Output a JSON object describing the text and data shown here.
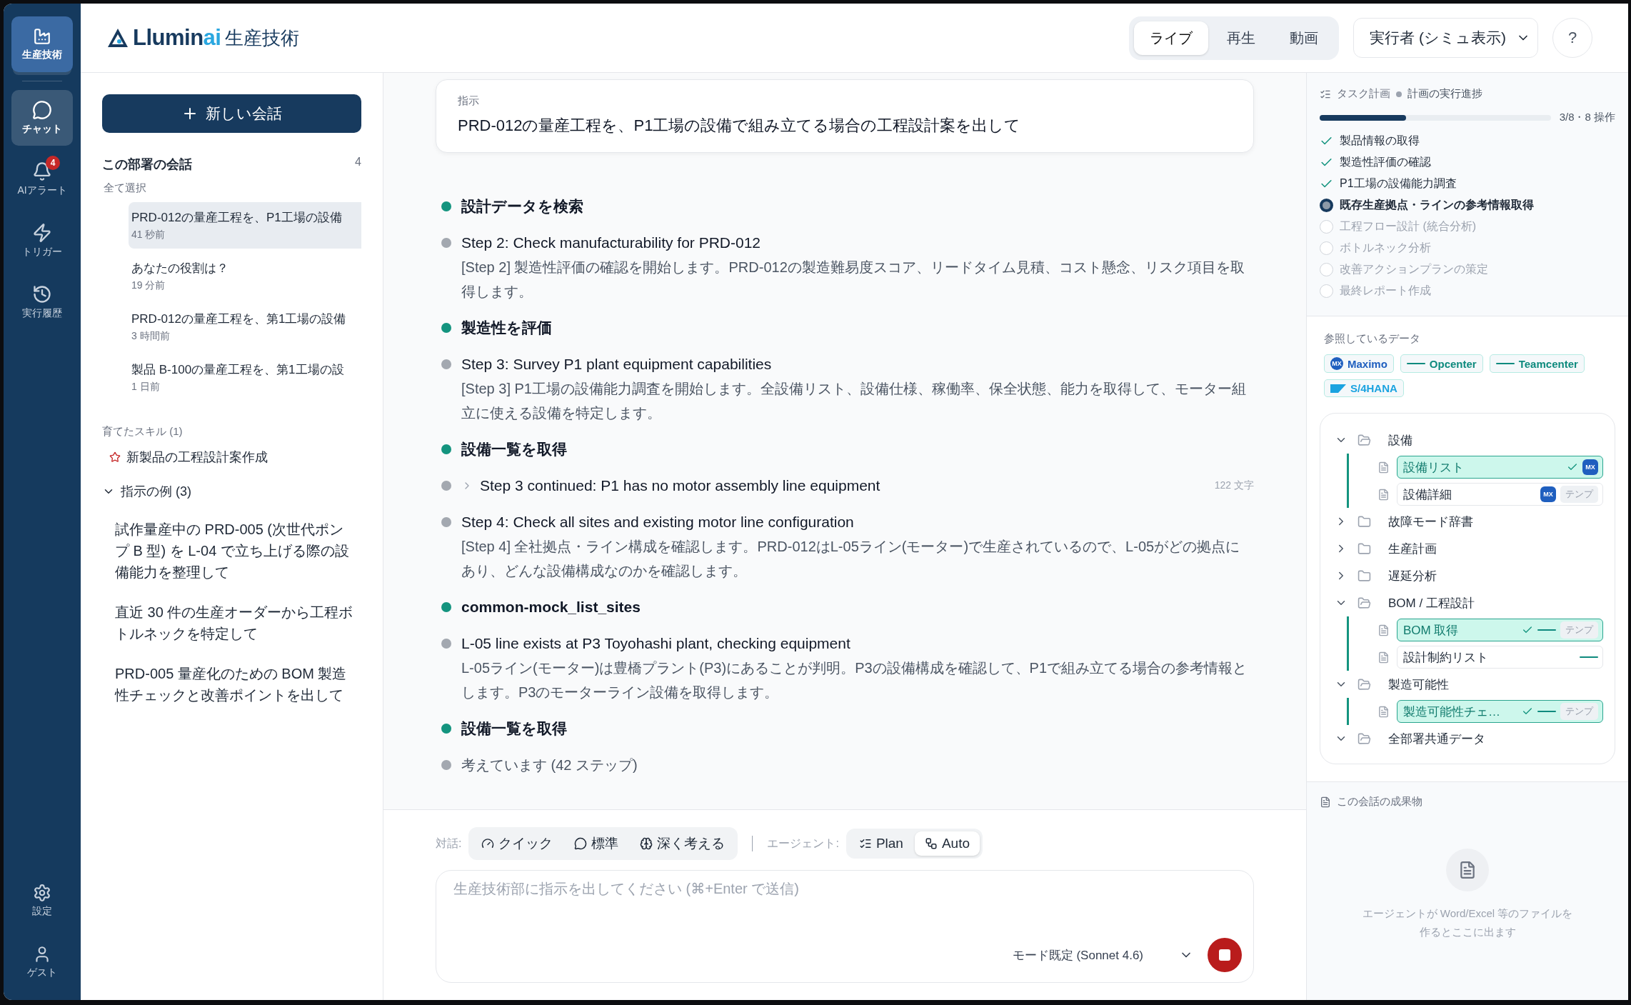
{
  "rail": {
    "app": {
      "label": "生産技術"
    },
    "items": [
      {
        "label": "チャット",
        "selected": true
      },
      {
        "label": "AIアラート",
        "selected": false,
        "badge": "4"
      },
      {
        "label": "トリガー",
        "selected": false
      },
      {
        "label": "実行履歴",
        "selected": false
      }
    ],
    "bottom_items": [
      {
        "label": "設定"
      },
      {
        "label": "ゲスト"
      }
    ]
  },
  "header": {
    "logo": {
      "main": "Llumin",
      "accent": "ai"
    },
    "title": "生産技術",
    "view_tabs": [
      {
        "label": "ライブ",
        "selected": true
      },
      {
        "label": "再生",
        "selected": false
      },
      {
        "label": "動画",
        "selected": false
      }
    ],
    "runner_select": {
      "value": "実行者 (シミュ表示)"
    },
    "help": "?"
  },
  "sidebar": {
    "new_chat": "新しい会話",
    "conversations_title": "この部署の会話",
    "conversations_count": "4",
    "select_all": "全て選択",
    "conversations": [
      {
        "title": "PRD-012の量産工程を、P1工場の設備",
        "time": "41 秒前",
        "selected": true
      },
      {
        "title": "あなたの役割は？",
        "time": "19 分前",
        "selected": false
      },
      {
        "title": "PRD-012の量産工程を、第1工場の設備",
        "time": "3 時間前",
        "selected": false
      },
      {
        "title": "製品 B-100の量産工程を、第1工場の設",
        "time": "1 日前",
        "selected": false
      }
    ],
    "skills_title": "育てたスキル (1)",
    "skills": [
      {
        "label": "新製品の工程設計案作成"
      }
    ],
    "examples": {
      "title": "指示の例 (3)",
      "expanded": true,
      "items": [
        "試作量産中の PRD-005 (次世代ポンプ B 型) を L-04 で立ち上げる際の設備能力を整理して",
        "直近 30 件の生産オーダーから工程ボトルネックを特定して",
        "PRD-005 量産化のための BOM 製造性チェックと改善ポイントを出して"
      ]
    }
  },
  "main": {
    "instruction": {
      "label": "指示",
      "text": "PRD-012の量産工程を、P1工場の設備で組み立てる場合の工程設計案を出して"
    },
    "steps": [
      {
        "kind": "action",
        "title": "設計データを検索"
      },
      {
        "kind": "step",
        "title": "Step 2: Check manufacturability for PRD-012",
        "body": "[Step 2] 製造性評価の確認を開始します。PRD-012の製造難易度スコア、リードタイム見積、コスト懸念、リスク項目を取得します。"
      },
      {
        "kind": "action",
        "title": "製造性を評価"
      },
      {
        "kind": "step",
        "title": "Step 3: Survey P1 plant equipment capabilities",
        "body": "[Step 3] P1工場の設備能力調査を開始します。全設備リスト、設備仕様、稼働率、保全状態、能力を取得して、モーター組立に使える設備を特定します。"
      },
      {
        "kind": "action",
        "title": "設備一覧を取得"
      },
      {
        "kind": "collapsed",
        "title": "Step 3 continued: P1 has no motor assembly line equipment",
        "meta": "122 文字"
      },
      {
        "kind": "step",
        "title": "Step 4: Check all sites and existing motor line configuration",
        "body": "[Step 4] 全社拠点・ライン構成を確認します。PRD-012はL-05ライン(モーター)で生産されているので、L-05がどの拠点にあり、どんな設備構成なのかを確認します。"
      },
      {
        "kind": "action",
        "title": "common-mock_list_sites"
      },
      {
        "kind": "step",
        "title": "L-05 line exists at P3 Toyohashi plant, checking equipment",
        "body": "L-05ライン(モーター)は豊橋プラント(P3)にあることが判明。P3の設備構成を確認して、P1で組み立てる場合の参考情報とします。P3のモーターライン設備を取得します。"
      },
      {
        "kind": "action",
        "title": "設備一覧を取得"
      },
      {
        "kind": "thinking",
        "title": "考えています (42 ステップ)"
      }
    ],
    "composer": {
      "dialog_label": "対話:",
      "dialog_modes": [
        {
          "label": "クイック",
          "selected": false
        },
        {
          "label": "標準",
          "selected": false
        },
        {
          "label": "深く考える",
          "selected": false
        }
      ],
      "agent_label": "エージェント:",
      "agent_modes": [
        {
          "label": "Plan",
          "selected": false
        },
        {
          "label": "Auto",
          "selected": true
        }
      ],
      "placeholder": "生産技術部に指示を出してください (⌘+Enter で送信)",
      "model": "モード既定 (Sonnet 4.6)"
    }
  },
  "right": {
    "plan": {
      "title": "タスク計画",
      "subtitle": "計画の実行進捗",
      "level": 0.375,
      "progress_text": "3/8・8 操作",
      "tasks": [
        {
          "label": "製品情報の取得",
          "done": true,
          "active": false
        },
        {
          "label": "製造性評価の確認",
          "done": true,
          "active": false
        },
        {
          "label": "P1工場の設備能力調査",
          "done": true,
          "active": false
        },
        {
          "label": "既存生産拠点・ラインの参考情報取得",
          "done": false,
          "active": true
        },
        {
          "label": "工程フロー設計 (統合分析)",
          "done": false,
          "active": false
        },
        {
          "label": "ボトルネック分析",
          "done": false,
          "active": false
        },
        {
          "label": "改善アクションプランの策定",
          "done": false,
          "active": false
        },
        {
          "label": "最終レポート作成",
          "done": false,
          "active": false
        }
      ]
    },
    "data_title": "参照しているデータ",
    "data_sources": [
      {
        "label": "Maximo",
        "kind": "mx",
        "logo_text": "MX",
        "color": "#1f5fbf"
      },
      {
        "label": "Opcenter",
        "kind": "siemens",
        "color": "#0e8a7e"
      },
      {
        "label": "Teamcenter",
        "kind": "siemens",
        "color": "#0e8a7e"
      },
      {
        "label": "S/4HANA",
        "kind": "sap",
        "color": "#1ba3e0"
      }
    ],
    "tree": [
      {
        "label": "設備",
        "expanded": true,
        "children": [
          {
            "label": "設備リスト",
            "used": true,
            "sources": [
              {
                "kind": "mx",
                "text": "MX"
              }
            ]
          },
          {
            "label": "設備詳細",
            "used": false,
            "sources": [
              {
                "kind": "mx",
                "text": "MX"
              }
            ],
            "tag": "テンプ"
          }
        ]
      },
      {
        "label": "故障モード辞書",
        "expanded": false
      },
      {
        "label": "生産計画",
        "expanded": false
      },
      {
        "label": "遅延分析",
        "expanded": false
      },
      {
        "label": "BOM / 工程設計",
        "expanded": true,
        "children": [
          {
            "label": "BOM 取得",
            "used": true,
            "sources": [
              {
                "kind": "siemens"
              }
            ],
            "tag": "テンプ"
          },
          {
            "label": "設計制約リスト",
            "used": false,
            "sources": [
              {
                "kind": "siemens"
              }
            ]
          }
        ]
      },
      {
        "label": "製造可能性",
        "expanded": true,
        "children": [
          {
            "label": "製造可能性チェ…",
            "used": true,
            "sources": [
              {
                "kind": "siemens"
              }
            ],
            "tag": "テンプ"
          }
        ]
      },
      {
        "label": "全部署共通データ",
        "expanded": true
      }
    ],
    "outputs": {
      "title": "この会話の成果物",
      "empty_text": "エージェントが Word/Excel 等のファイルを作るとここに出ます"
    }
  }
}
